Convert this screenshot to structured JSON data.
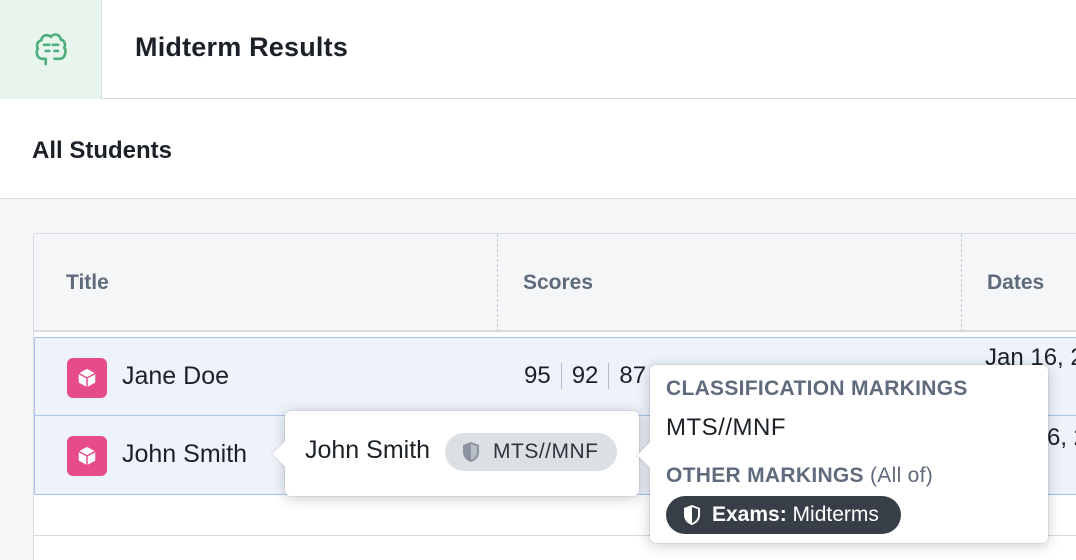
{
  "header": {
    "title": "Midterm Results",
    "logo_icon": "brain-icon",
    "logo_bg": "#e8f5ec"
  },
  "section": {
    "title": "All Students"
  },
  "table": {
    "columns": [
      "Title",
      "Scores",
      "Dates"
    ],
    "rows": [
      {
        "name": "Jane Doe",
        "scores": [
          "95",
          "92",
          "87"
        ],
        "date": "Jan 16, 2",
        "icon": "cube-icon"
      },
      {
        "name": "John Smith",
        "scores": [],
        "date": "6, 2",
        "icon": "cube-icon"
      }
    ]
  },
  "popover_left": {
    "name": "John Smith",
    "tag": "MTS//MNF",
    "tag_icon": "shield-icon"
  },
  "popover_right": {
    "classification_title": "CLASSIFICATION MARKINGS",
    "classification_value": "MTS//MNF",
    "other_title": "OTHER MARKINGS",
    "other_qualifier": "(All of)",
    "pill_key": "Exams:",
    "pill_value": " Midterms",
    "pill_icon": "shield-icon"
  },
  "colors": {
    "accent_pink": "#e64b8b",
    "row_selected": "#eef3fb",
    "row_border": "#a8c5ee",
    "pill_dark": "#383e47"
  }
}
